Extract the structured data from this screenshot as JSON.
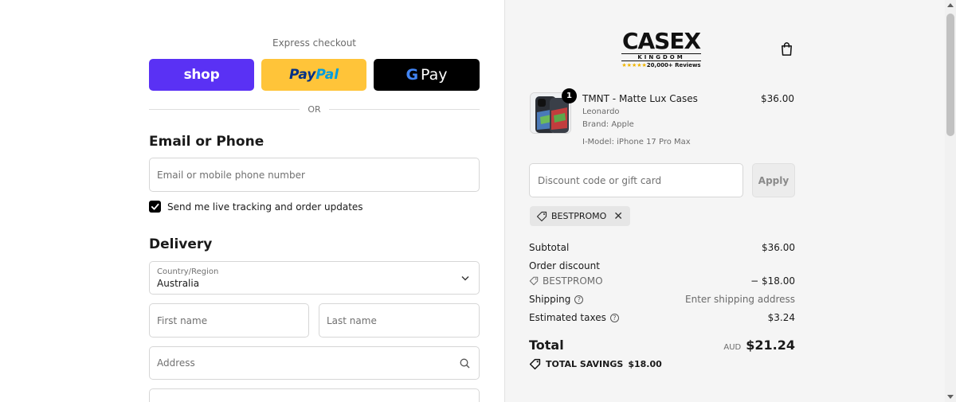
{
  "express": {
    "label": "Express checkout",
    "shop_label": "shop",
    "paypal_part1": "Pay",
    "paypal_part2": "Pal",
    "gpay_g": "G",
    "gpay_label": "Pay",
    "or_text": "OR"
  },
  "contact": {
    "title": "Email or Phone",
    "email_placeholder": "Email or mobile phone number",
    "tracking_label": "Send me live tracking and order updates",
    "tracking_checked": true
  },
  "delivery": {
    "title": "Delivery",
    "country_label": "Country/Region",
    "country_value": "Australia",
    "first_name_placeholder": "First name",
    "last_name_placeholder": "Last name",
    "address_placeholder": "Address"
  },
  "store": {
    "logo_main": "CASEX",
    "logo_sub": "KINGDOM",
    "logo_stars": "★★★★★",
    "logo_reviews": "20,000+ Reviews"
  },
  "cart_item": {
    "quantity": "1",
    "name": "TMNT - Matte Lux Cases",
    "variant": "Leonardo",
    "brand": "Brand: Apple",
    "model": "I-Model: iPhone 17 Pro Max",
    "price": "$36.00"
  },
  "discount": {
    "placeholder": "Discount code or gift card",
    "apply_label": "Apply",
    "applied_code": "BESTPROMO"
  },
  "summary": {
    "subtotal_label": "Subtotal",
    "subtotal_value": "$36.00",
    "order_discount_label": "Order discount",
    "discount_code": "BESTPROMO",
    "discount_value": "− $18.00",
    "shipping_label": "Shipping",
    "shipping_value": "Enter shipping address",
    "taxes_label": "Estimated taxes",
    "taxes_value": "$3.24",
    "total_label": "Total",
    "currency": "AUD",
    "total_value": "$21.24",
    "savings_label": "TOTAL SAVINGS",
    "savings_value": "$18.00"
  },
  "colors": {
    "shop_purple": "#5a31f4",
    "paypal_yellow": "#ffc439",
    "gpay_black": "#000000",
    "summary_bg": "#f5f5f5"
  }
}
